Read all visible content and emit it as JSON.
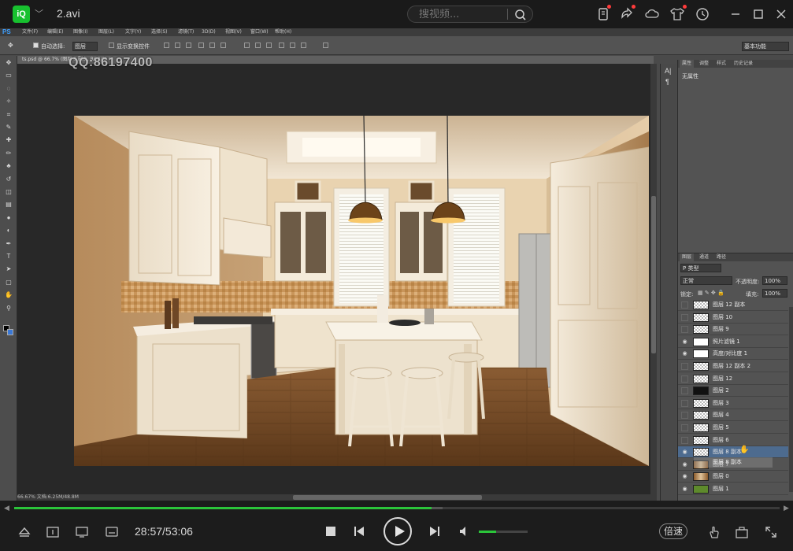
{
  "player": {
    "title": "2.avi",
    "logo_text": "iQ",
    "search_placeholder": "搜视频...",
    "time_display": "28:57/53:06",
    "speed_label": "倍速",
    "progress": 0.545,
    "buffered": 0.56,
    "volume": 0.35,
    "accent_color": "#2bc53a"
  },
  "photoshop": {
    "logo": "PS",
    "menus": [
      "文件(F)",
      "编辑(E)",
      "图像(I)",
      "图层(L)",
      "文字(Y)",
      "选择(S)",
      "滤镜(T)",
      "3D(D)",
      "视图(V)",
      "窗口(W)",
      "帮助(H)"
    ],
    "options": {
      "auto_select": "自动选择:",
      "auto_select_value": "图层",
      "show_transform": "显示变换控件",
      "workspace": "基本功能"
    },
    "doc_tab": "ts.psd @ 66.7% (图层 8 副本, RGB/8) *",
    "watermark": "QQ:86197400",
    "status": "66.67%     文档:6.25M/48.8M",
    "properties": {
      "tabs": [
        "属性",
        "调整",
        "样式",
        "历史记录"
      ],
      "content": "无属性"
    },
    "layers_panel": {
      "tabs": [
        "图层",
        "通道",
        "路径"
      ],
      "filter_kind": "P 类型",
      "blend_mode": "正常",
      "opacity_label": "不透明度:",
      "opacity_value": "100%",
      "lock_label": "锁定:",
      "fill_label": "填充:",
      "fill_value": "100%",
      "drag_ghost": "图层 8 副本",
      "layers": [
        {
          "name": "图层 12 副本",
          "visible": false,
          "thumb": "checker"
        },
        {
          "name": "图层 10",
          "visible": false,
          "thumb": "checker"
        },
        {
          "name": "图层 9",
          "visible": false,
          "thumb": "checker"
        },
        {
          "name": "照片滤镜 1",
          "visible": true,
          "thumb": "white"
        },
        {
          "name": "高度/对比度 1",
          "visible": true,
          "thumb": "white"
        },
        {
          "name": "图层 12 副本 2",
          "visible": false,
          "thumb": "checker"
        },
        {
          "name": "图层 12",
          "visible": false,
          "thumb": "checker"
        },
        {
          "name": "图层 2",
          "visible": false,
          "thumb": "dark"
        },
        {
          "name": "图层 3",
          "visible": false,
          "thumb": "checker"
        },
        {
          "name": "图层 4",
          "visible": false,
          "thumb": "checker"
        },
        {
          "name": "图层 5",
          "visible": false,
          "thumb": "checker"
        },
        {
          "name": "图层 6",
          "visible": false,
          "thumb": "checker"
        },
        {
          "name": "图层 8 副本",
          "visible": true,
          "thumb": "checker",
          "selected": true
        },
        {
          "name": "图层 7",
          "visible": true,
          "thumb": "kitchen"
        },
        {
          "name": "图层 0",
          "visible": true,
          "thumb": "kitchen"
        },
        {
          "name": "图层 1",
          "visible": true,
          "thumb": "green"
        }
      ]
    }
  }
}
